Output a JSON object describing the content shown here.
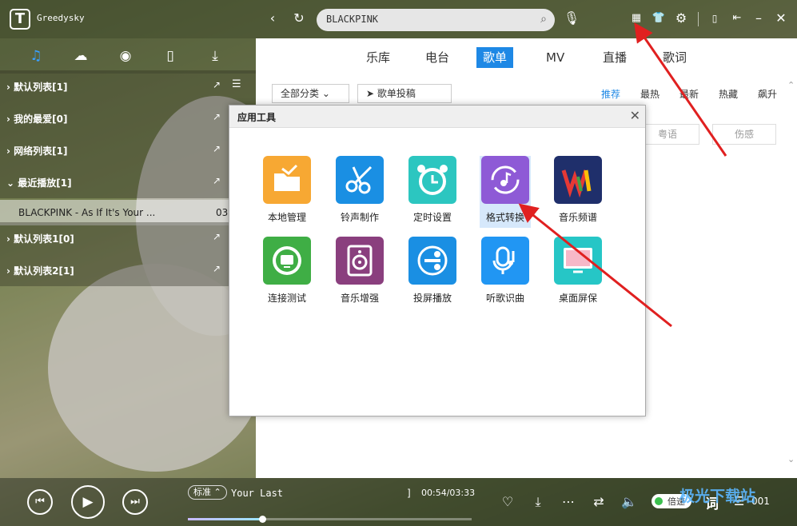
{
  "app": {
    "logo_letter": "T",
    "username": "Greedysky"
  },
  "search": {
    "query": "BLACKPINK"
  },
  "sidebar": {
    "playlists": [
      {
        "label": "默认列表[1]"
      },
      {
        "label": "我的最爱[0]"
      },
      {
        "label": "网络列表[1]"
      },
      {
        "label": "最近播放[1]"
      },
      {
        "label": "默认列表1[0]"
      },
      {
        "label": "默认列表2[1]"
      }
    ],
    "song": {
      "title": "BLACKPINK - As If It's Your ...",
      "time": "03:"
    }
  },
  "nav": {
    "tabs": [
      "乐库",
      "电台",
      "歌单",
      "MV",
      "直播",
      "歌词"
    ],
    "active": "歌单"
  },
  "toolbar": {
    "category": "全部分类",
    "submit": "歌单投稿"
  },
  "filters": [
    "推荐",
    "最热",
    "最新",
    "热藏",
    "飙升"
  ],
  "tags": [
    "粤语",
    "伤感"
  ],
  "dialog": {
    "title": "应用工具",
    "tools": [
      {
        "label": "本地管理",
        "icon": "folder-icon"
      },
      {
        "label": "铃声制作",
        "icon": "scissors-icon"
      },
      {
        "label": "定时设置",
        "icon": "alarm-clock-icon"
      },
      {
        "label": "格式转换",
        "icon": "convert-icon"
      },
      {
        "label": "音乐频谱",
        "icon": "spectrum-icon"
      },
      {
        "label": "连接测试",
        "icon": "globe-icon"
      },
      {
        "label": "音乐增强",
        "icon": "speaker-icon"
      },
      {
        "label": "投屏播放",
        "icon": "cast-icon"
      },
      {
        "label": "听歌识曲",
        "icon": "mic-note-icon"
      },
      {
        "label": "桌面屏保",
        "icon": "screensaver-icon"
      }
    ]
  },
  "player": {
    "quality": "标准",
    "title": "Your Last",
    "bracket": "]",
    "time": "00:54/03:33",
    "progress": 0.262,
    "toggle_label": "倍速",
    "lyric_label": "词",
    "count": "001"
  },
  "watermark": "极光下载站",
  "colors": {
    "accent": "#1e88e5",
    "arrow": "#e02020"
  }
}
